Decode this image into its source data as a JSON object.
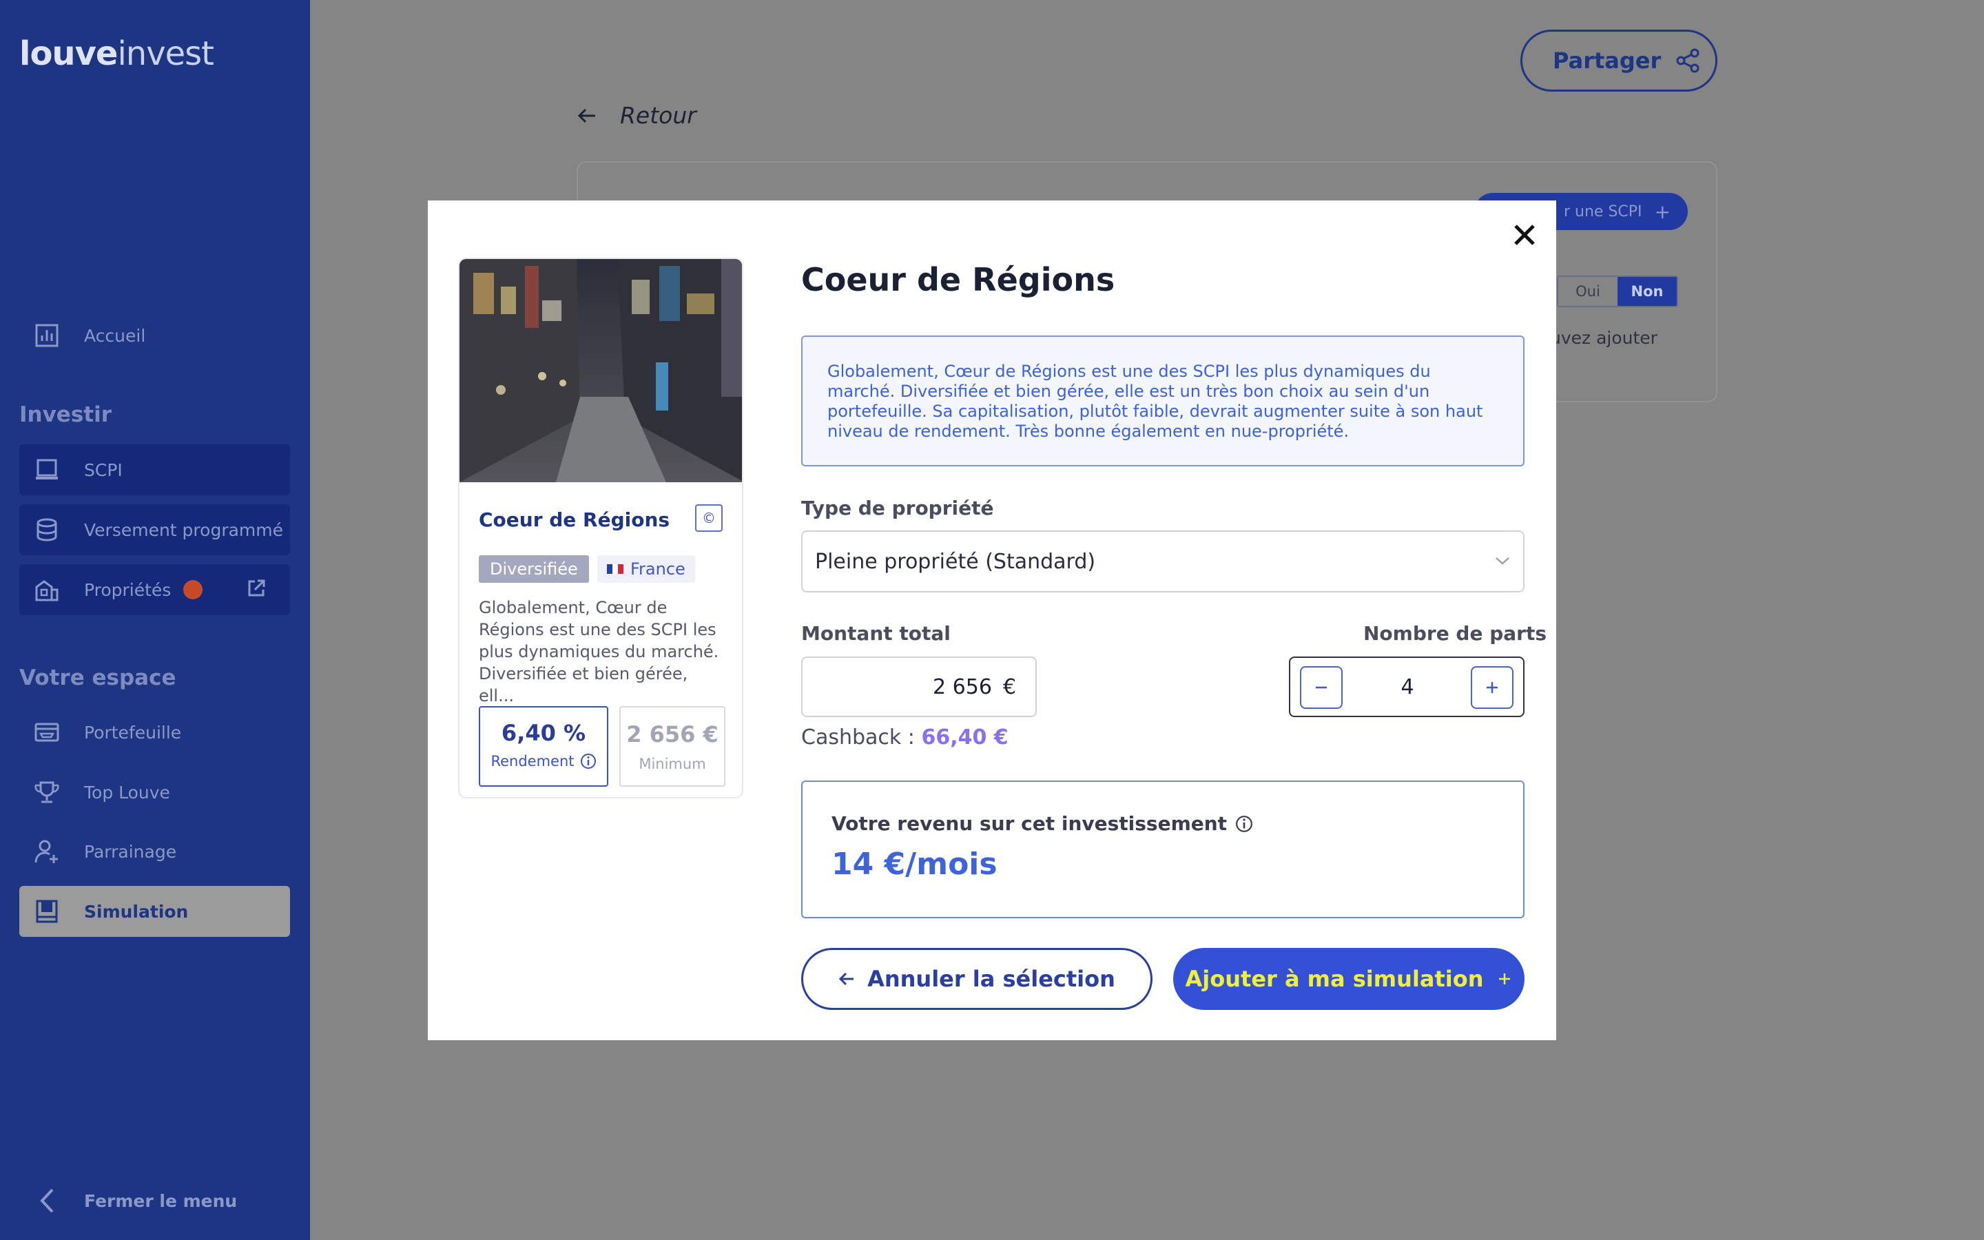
{
  "sidebar": {
    "logo": {
      "bold": "louve",
      "thin": "invest"
    },
    "items": {
      "accueil": "Accueil",
      "scpi": "SCPI",
      "versement": "Versement programmé",
      "proprietes": "Propriétés",
      "portefeuille": "Portefeuille",
      "top_louve": "Top Louve",
      "parrainage": "Parrainage",
      "simulation": "Simulation"
    },
    "sections": {
      "investir": "Investir",
      "espace": "Votre espace"
    },
    "close_menu": "Fermer le menu"
  },
  "page": {
    "share_label": "Partager",
    "back_label": "Retour",
    "add_scpi_label": "r une SCPI",
    "toggle": {
      "yes": "Oui",
      "no": "Non"
    },
    "bg_text": "uvez ajouter"
  },
  "modal": {
    "title": "Coeur de Régions",
    "description": "Globalement, Cœur de Régions est une des SCPI les plus dynamiques du marché. Diversifiée et bien gérée, elle est un très bon choix au sein d'un portefeuille. Sa capitalisation, plutôt faible, devrait augmenter suite à son haut niveau de rendement. Très bonne également en nue-propriété.",
    "property_type_label": "Type de propriété",
    "property_type_value": "Pleine propriété (Standard)",
    "amount_label": "Montant total",
    "amount_value": "2 656",
    "currency": "€",
    "shares_label": "Nombre de parts",
    "shares_value": "4",
    "cashback_label": "Cashback :",
    "cashback_value": "66,40 €",
    "revenue_label": "Votre revenu sur cet investissement",
    "revenue_value": "14 €/mois",
    "cancel_label": "Annuler la sélection",
    "add_label": "Ajouter à ma simulation"
  },
  "card": {
    "title": "Coeur de Régions",
    "badge": "©",
    "tag_category": "Diversifiée",
    "tag_country": "France",
    "description": "Globalement, Cœur de Régions est une des SCPI les plus dynamiques du marché. Diversifiée et bien gérée, ell...",
    "yield_value": "6,40 %",
    "yield_label": "Rendement",
    "min_value": "2 656 €",
    "min_label": "Minimum"
  },
  "colors": {
    "sidebar": "#1d3582",
    "accent": "#3450d6",
    "add_button_text": "#eef03a",
    "cashback": "#8a6ff0"
  }
}
